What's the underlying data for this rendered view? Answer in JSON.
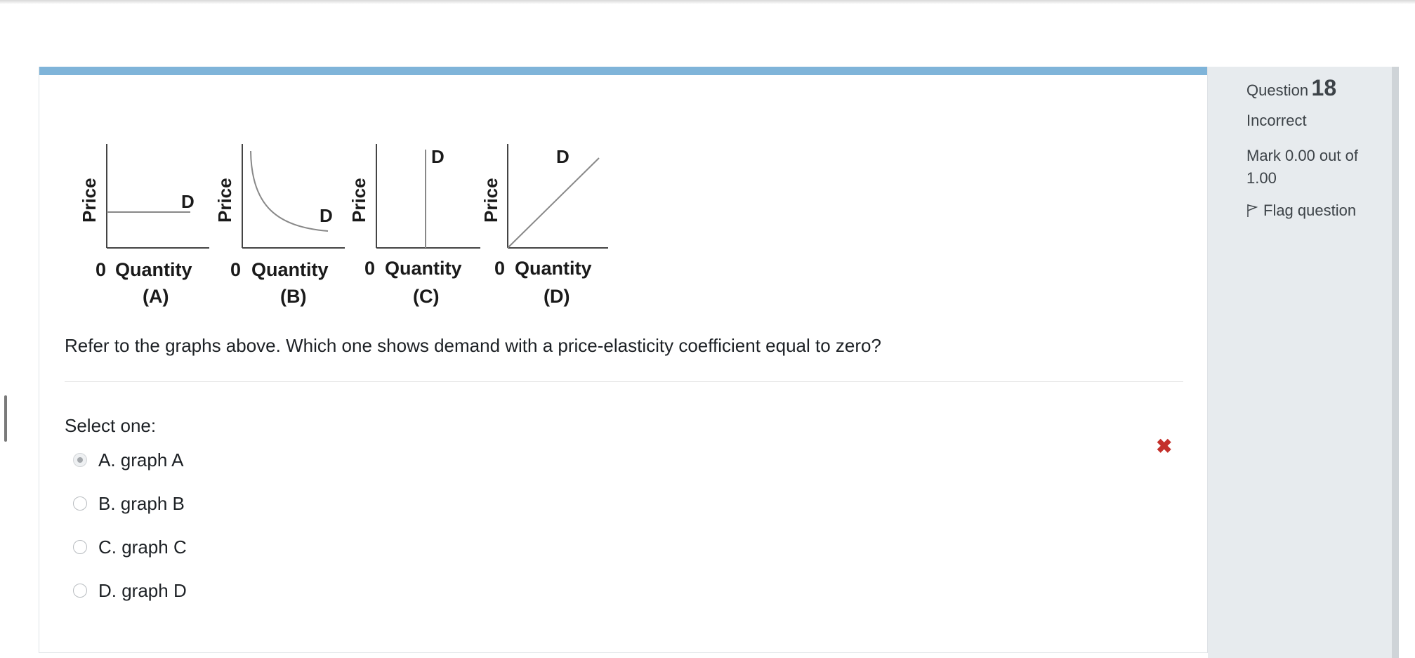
{
  "graphs": [
    {
      "y_label": "Price",
      "zero": "0",
      "x_label": "Quantity",
      "tag": "(A)",
      "curve_label": "D"
    },
    {
      "y_label": "Price",
      "zero": "0",
      "x_label": "Quantity",
      "tag": "(B)",
      "curve_label": "D"
    },
    {
      "y_label": "Price",
      "zero": "0",
      "x_label": "Quantity",
      "tag": "(C)",
      "curve_label": "D"
    },
    {
      "y_label": "Price",
      "zero": "0",
      "x_label": "Quantity",
      "tag": "(D)",
      "curve_label": "D"
    }
  ],
  "question": {
    "text": "Refer to the graphs above. Which one shows demand with a price-elasticity coefficient equal to zero?",
    "prompt": "Select one:",
    "options": [
      {
        "label": "A. graph A",
        "selected": true
      },
      {
        "label": "B. graph B",
        "selected": false
      },
      {
        "label": "C. graph C",
        "selected": false
      },
      {
        "label": "D. graph D",
        "selected": false
      }
    ],
    "result_icon": "✖",
    "result_icon_name": "incorrect-x-icon",
    "result_color": "#c4302b"
  },
  "info": {
    "question_label": "Question",
    "question_number": "18",
    "state": "Incorrect",
    "grade": "Mark 0.00 out of 1.00",
    "flag_label": "Flag question",
    "flag_icon": "flag-icon"
  },
  "colors": {
    "accent_bar": "#7fb4d9",
    "info_panel": "#e7ebee"
  }
}
